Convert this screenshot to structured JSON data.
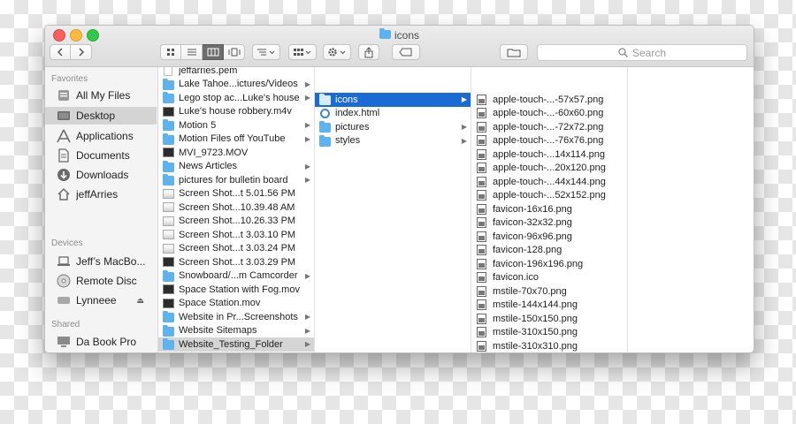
{
  "window": {
    "title": "icons"
  },
  "toolbar": {
    "back_icon": "chevron-left-icon",
    "forward_icon": "chevron-right-icon",
    "views": [
      "icon-view-icon",
      "list-view-icon",
      "column-view-icon",
      "coverflow-view-icon"
    ],
    "arrange_icon": "arrange-icon",
    "group_icon": "group-icon",
    "action_icon": "gear-icon",
    "share_icon": "share-icon",
    "tag_icon": "tag-icon",
    "new_folder_icon": "folder-icon",
    "search_placeholder": "Search"
  },
  "sidebar": {
    "favorites_header": "Favorites",
    "favorites": [
      {
        "label": "All My Files",
        "icon": "all-files-icon"
      },
      {
        "label": "Desktop",
        "icon": "desktop-icon",
        "selected": true
      },
      {
        "label": "Applications",
        "icon": "applications-icon"
      },
      {
        "label": "Documents",
        "icon": "documents-icon"
      },
      {
        "label": "Downloads",
        "icon": "downloads-icon"
      },
      {
        "label": "jeffArries",
        "icon": "home-icon"
      }
    ],
    "devices_header": "Devices",
    "devices": [
      {
        "label": "Jeff’s MacBo...",
        "icon": "laptop-icon"
      },
      {
        "label": "Remote Disc",
        "icon": "disc-icon"
      },
      {
        "label": "Lynneee",
        "icon": "drive-icon",
        "eject": true
      }
    ],
    "shared_header": "Shared",
    "shared": [
      {
        "label": "Da Book Pro",
        "icon": "computer-icon"
      }
    ]
  },
  "column1": [
    {
      "label": "jeffarries.pem",
      "kind": "doc"
    },
    {
      "label": "Lake Tahoe...ictures/Videos",
      "kind": "folder",
      "arrow": true
    },
    {
      "label": "Lego stop ac...Luke's house",
      "kind": "folder",
      "arrow": true
    },
    {
      "label": "Luke's house robbery.m4v",
      "kind": "thumb"
    },
    {
      "label": "Motion 5",
      "kind": "folder",
      "arrow": true
    },
    {
      "label": "Motion Files off YouTube",
      "kind": "folder",
      "arrow": true
    },
    {
      "label": "MVI_9723.MOV",
      "kind": "thumb"
    },
    {
      "label": "News Articles",
      "kind": "folder",
      "arrow": true
    },
    {
      "label": "pictures for bulletin board",
      "kind": "folder",
      "arrow": true
    },
    {
      "label": "Screen Shot...t 5.01.56 PM",
      "kind": "screen"
    },
    {
      "label": "Screen Shot...10.39.48 AM",
      "kind": "screen"
    },
    {
      "label": "Screen Shot...10.26.33 PM",
      "kind": "screen"
    },
    {
      "label": "Screen Shot...t 3.03.10 PM",
      "kind": "screen"
    },
    {
      "label": "Screen Shot...t 3.03.24 PM",
      "kind": "screen"
    },
    {
      "label": "Screen Shot...t 3.03.29 PM",
      "kind": "thumb"
    },
    {
      "label": "Snowboard/...m Camcorder",
      "kind": "folder",
      "arrow": true
    },
    {
      "label": "Space Station with Fog.mov",
      "kind": "thumb"
    },
    {
      "label": "Space Station.mov",
      "kind": "thumb"
    },
    {
      "label": "Website in Pr...Screenshots",
      "kind": "folder",
      "arrow": true
    },
    {
      "label": "Website Sitemaps",
      "kind": "folder",
      "arrow": true
    },
    {
      "label": "Website_Testing_Folder",
      "kind": "folder",
      "arrow": true,
      "selected": true
    }
  ],
  "column2": [
    {
      "label": "icons",
      "kind": "folder",
      "arrow": true,
      "selected": true
    },
    {
      "label": "index.html",
      "kind": "html"
    },
    {
      "label": "pictures",
      "kind": "folder",
      "arrow": true
    },
    {
      "label": "styles",
      "kind": "folder",
      "arrow": true
    }
  ],
  "column3": [
    {
      "label": "apple-touch-...-57x57.png"
    },
    {
      "label": "apple-touch-...-60x60.png"
    },
    {
      "label": "apple-touch-...-72x72.png"
    },
    {
      "label": "apple-touch-...-76x76.png"
    },
    {
      "label": "apple-touch-...14x114.png"
    },
    {
      "label": "apple-touch-...20x120.png"
    },
    {
      "label": "apple-touch-...44x144.png"
    },
    {
      "label": "apple-touch-...52x152.png"
    },
    {
      "label": "favicon-16x16.png"
    },
    {
      "label": "favicon-32x32.png"
    },
    {
      "label": "favicon-96x96.png"
    },
    {
      "label": "favicon-128.png"
    },
    {
      "label": "favicon-196x196.png"
    },
    {
      "label": "favicon.ico"
    },
    {
      "label": "mstile-70x70.png"
    },
    {
      "label": "mstile-144x144.png"
    },
    {
      "label": "mstile-150x150.png"
    },
    {
      "label": "mstile-310x150.png"
    },
    {
      "label": "mstile-310x310.png"
    }
  ]
}
